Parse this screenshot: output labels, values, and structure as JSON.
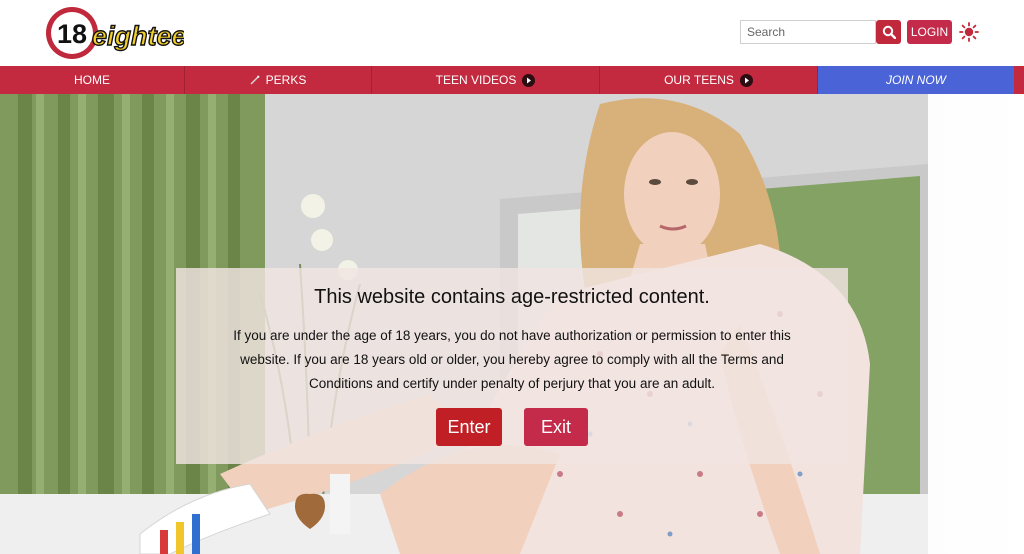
{
  "header": {
    "logo_text": {
      "number": "18",
      "word": "eighteen"
    },
    "search": {
      "placeholder": "Search",
      "value": ""
    },
    "search_icon": "magnifier-icon",
    "login_label": "LOGIN",
    "theme_icon": "sun-icon"
  },
  "nav": {
    "items": [
      {
        "label": "HOME",
        "has_arrow": false
      },
      {
        "label": "PERKS",
        "icon": "sparkle-icon",
        "has_arrow": false
      },
      {
        "label": "TEEN VIDEOS",
        "has_arrow": true
      },
      {
        "label": "OUR TEENS",
        "has_arrow": true
      },
      {
        "label": "JOIN NOW",
        "has_arrow": false
      }
    ]
  },
  "age_gate": {
    "title": "This website contains age-restricted content.",
    "message": "If you are under the age of 18 years, you do not have authorization or permission to enter this website. If you are 18 years old or older, you hereby agree to comply with all the Terms and Conditions and certify under penalty of perjury that you are an adult.",
    "enter_label": "Enter",
    "exit_label": "Exit"
  },
  "colors": {
    "brand_red": "#c0283b",
    "nav_red": "#c42a3f",
    "join_blue": "#4a64d8",
    "enter_red": "#c01f26",
    "exit_red": "#c42a4a"
  }
}
